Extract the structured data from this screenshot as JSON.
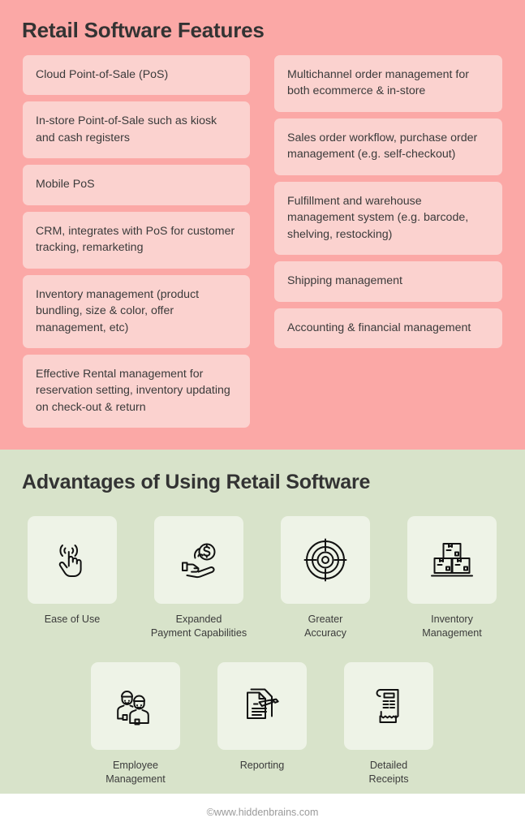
{
  "features": {
    "title": "Retail Software Features",
    "background_color": "#fba8a6",
    "card_color": "#fbd2cf",
    "left_column": [
      {
        "text": "Cloud Point-of-Sale (PoS)"
      },
      {
        "text": "In-store Point-of-Sale such as kiosk and cash registers"
      },
      {
        "text": "Mobile PoS"
      },
      {
        "text": "CRM, integrates with PoS for customer tracking, remarketing"
      },
      {
        "text": "Inventory management (product bundling, size & color, offer management, etc)"
      },
      {
        "text": "Effective Rental management for reservation setting, inventory updating on check-out & return"
      }
    ],
    "right_column": [
      {
        "text": "Multichannel order management for both ecommerce & in-store"
      },
      {
        "text": "Sales order workflow, purchase order management (e.g. self-checkout)"
      },
      {
        "text": "Fulfillment and warehouse management system (e.g. barcode, shelving, restocking)"
      },
      {
        "text": "Shipping management"
      },
      {
        "text": "Accounting & financial management"
      }
    ]
  },
  "advantages": {
    "title": "Advantages of Using Retail Software",
    "background_color": "#d8e3ca",
    "tile_color": "#eef3e7",
    "items": [
      {
        "label": "Ease of Use",
        "icon": "tap-hand-icon"
      },
      {
        "label": "Expanded\nPayment Capabilities",
        "icon": "hand-holding-coin-icon"
      },
      {
        "label": "Greater\nAccuracy",
        "icon": "target-icon"
      },
      {
        "label": "Inventory\nManagement",
        "icon": "stacked-boxes-icon"
      },
      {
        "label": "Employee\nManagement",
        "icon": "two-employees-icon"
      },
      {
        "label": "Reporting",
        "icon": "document-pencil-icon"
      },
      {
        "label": "Detailed\nReceipts",
        "icon": "receipt-icon"
      }
    ]
  },
  "footer": {
    "text": "©www.hiddenbrains.com"
  }
}
